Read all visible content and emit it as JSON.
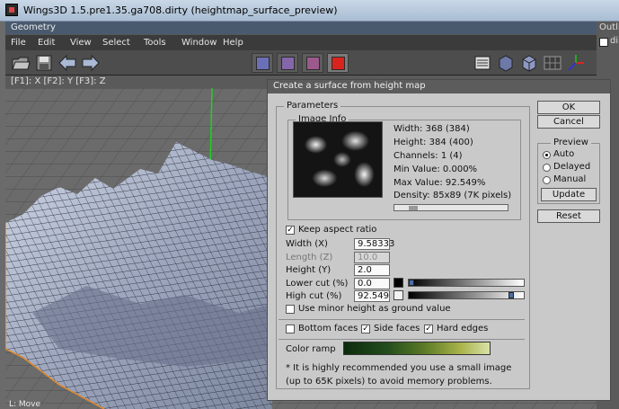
{
  "window": {
    "title": "Wings3D 1.5.pre1.35.ga708.dirty (heightmap_surface_preview)",
    "outliner_tab": "Outli",
    "outliner_item": "di"
  },
  "geometry": {
    "title": "Geometry",
    "menu": [
      "File",
      "Edit",
      "View",
      "Select",
      "Tools",
      "Window",
      "Help"
    ],
    "hotkeys": "[F1]: X    [F2]: Y    [F3]: Z",
    "status": "L: Move"
  },
  "toolbar": {
    "left_icons": [
      "open-folder-icon",
      "save-icon",
      "undo-arrow-icon",
      "redo-arrow-icon"
    ],
    "selection_modes": [
      "vertex-mode-icon",
      "edge-mode-icon",
      "face-mode-icon",
      "body-mode-icon"
    ],
    "right_icons": [
      "workmode-icon",
      "smooth-shading-icon",
      "wireframe-icon",
      "ground-plane-icon",
      "axes-icon"
    ]
  },
  "dialog": {
    "title": "Create a surface from height map",
    "parameters_legend": "Parameters",
    "image_info_legend": "Image Info",
    "info": {
      "width": "Width: 368 (384)",
      "height": "Height: 384 (400)",
      "channels": "Channels: 1 (4)",
      "min_value": "Min Value: 0.000%",
      "max_value": "Max Value: 92.549%",
      "density": "Density:  85x89 (7K pixels)"
    },
    "keep_aspect": {
      "label": "Keep aspect ratio",
      "checked": true
    },
    "fields": {
      "width": {
        "label": "Width (X)",
        "value": "9.58333"
      },
      "length": {
        "label": "Length (Z)",
        "value": "10.0"
      },
      "height": {
        "label": "Height (Y)",
        "value": "2.0"
      },
      "lower_cut": {
        "label": "Lower cut (%)",
        "value": "0.0"
      },
      "high_cut": {
        "label": "High cut (%)",
        "value": "92.549"
      }
    },
    "lower_cut_level": 0.0,
    "high_cut_level": 0.92549,
    "minor_height": {
      "label": "Use minor height as ground value",
      "checked": false
    },
    "bottom_faces": {
      "label": "Bottom faces",
      "checked": false
    },
    "side_faces": {
      "label": "Side faces",
      "checked": true
    },
    "hard_edges": {
      "label": "Hard edges",
      "checked": true
    },
    "color_ramp_label": "Color ramp",
    "note_line1": "* It is highly recommended you use a small image",
    "note_line2": "(up to 65K pixels) to avoid memory problems.",
    "buttons": {
      "ok": "OK",
      "cancel": "Cancel",
      "update": "Update",
      "reset": "Reset"
    },
    "preview": {
      "legend": "Preview",
      "options": [
        "Auto",
        "Delayed",
        "Manual"
      ],
      "selected": "Auto"
    }
  }
}
